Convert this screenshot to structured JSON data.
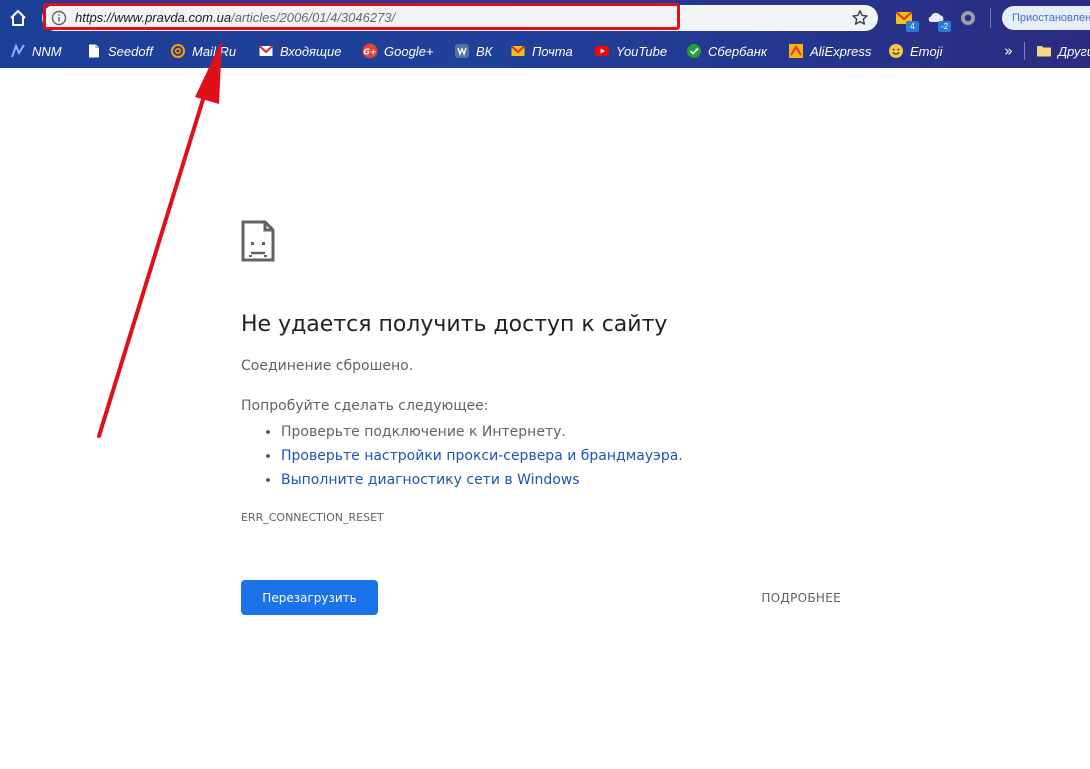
{
  "toolbar": {
    "url_host": "https://www.pravda.com.ua",
    "url_path": "/articles/2006/01/4/3046273/",
    "extension_badges": [
      "4",
      "-2"
    ],
    "paused_label": "Приостановлено"
  },
  "bookmarks": {
    "items": [
      {
        "label": "NNM",
        "icon": "nnm-icon"
      },
      {
        "label": "Seedoff",
        "icon": "page-icon"
      },
      {
        "label": "Mail.Ru",
        "icon": "at-icon"
      },
      {
        "label": "Входящие",
        "icon": "gmail-icon"
      },
      {
        "label": "Google+",
        "icon": "google-plus-icon"
      },
      {
        "label": "ВК",
        "icon": "vk-icon"
      },
      {
        "label": "Почта",
        "icon": "mail-icon"
      },
      {
        "label": "YouTube",
        "icon": "youtube-icon"
      },
      {
        "label": "Сбербанк",
        "icon": "sberbank-icon"
      },
      {
        "label": "AliExpress",
        "icon": "aliexpress-icon"
      },
      {
        "label": "Emoji",
        "icon": "emoji-icon"
      }
    ],
    "more": "»",
    "other_label": "Другие закладки"
  },
  "error": {
    "title": "Не удается получить доступ к сайту",
    "subtitle": "Соединение сброшено.",
    "try_label": "Попробуйте сделать следующее:",
    "suggestions": [
      "Проверьте подключение к Интернету.",
      "Проверьте настройки прокси-сервера и брандмауэра.",
      "Выполните диагностику сети в Windows"
    ],
    "code": "ERR_CONNECTION_RESET",
    "reload_label": "Перезагрузить",
    "details_label": "ПОДРОБНЕЕ"
  },
  "colors": {
    "chrome": "#20409a",
    "accent": "#1a73e8",
    "link": "#1a55b8",
    "annotation": "#e0101a"
  }
}
